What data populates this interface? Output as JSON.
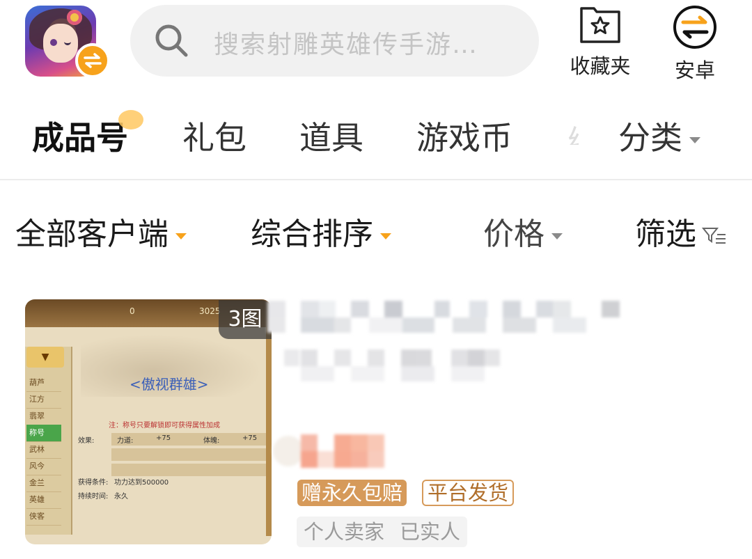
{
  "header": {
    "search_placeholder": "搜索射雕英雄传手游…",
    "favorites_label": "收藏夹",
    "platform_label": "安卓"
  },
  "categories": {
    "tabs": [
      "成品号",
      "礼包",
      "道具",
      "游戏币"
    ],
    "more_label": "分类"
  },
  "filters": {
    "client": "全部客户端",
    "sort": "综合排序",
    "price": "价格",
    "filter": "筛选"
  },
  "listing": {
    "image_count": "3图",
    "screenshot": {
      "coins": "0",
      "gold": "3025",
      "panel_title": "<傲视群雄>",
      "note": "注：称号只要解锁即可获得属性加成",
      "attr_label": "效果:",
      "attr1_name": "力道:",
      "attr1_value": "+75",
      "attr2_name": "体魄:",
      "attr2_value": "+75",
      "cond_label": "获得条件:",
      "cond_value": "功力达到500000",
      "duration_label": "持续时间:",
      "duration_value": "永久",
      "sidebar_head": "▼",
      "sidebar_items": [
        "葫芦",
        "江方",
        "翡翠",
        "称号",
        "武林",
        "风今",
        "金兰",
        "英雄",
        "侠客"
      ]
    },
    "tags": [
      "赠永久包赔",
      "平台发货"
    ],
    "seller": [
      "个人卖家",
      "已实人"
    ]
  },
  "colors": {
    "accent_orange": "#f7a21b",
    "tag_brown": "#d69a5a"
  }
}
